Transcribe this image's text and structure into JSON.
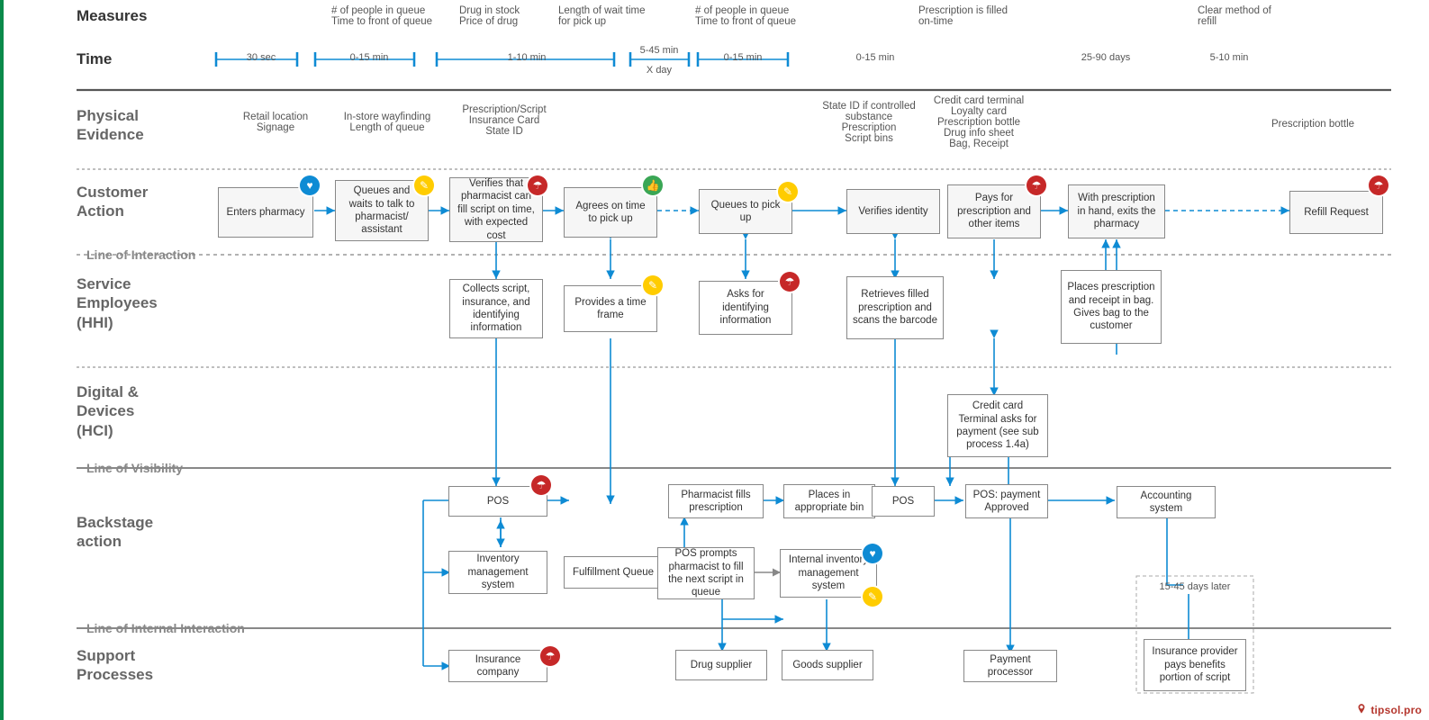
{
  "headers": {
    "measures": "Measures",
    "time": "Time",
    "physical": "Physical\nEvidence",
    "customer": "Customer\nAction",
    "service": "Service\nEmployees\n(HHI)",
    "digital": "Digital &\nDevices\n(HCI)",
    "backstage": "Backstage\naction",
    "support": "Support\nProcesses",
    "loi": "Line of Interaction",
    "lov": "Line of Visibility",
    "loii": "Line of Internal Interaction"
  },
  "measures": [
    "# of people in queue\nTime to front of queue",
    "Drug in stock\nPrice of drug",
    "Length of wait time\nfor pick up",
    "# of people in queue\nTime to front of queue",
    "Prescription is filled\non-time",
    "Clear method of\nrefill"
  ],
  "times": [
    "30 sec",
    "0-15 min",
    "1-10 min",
    "5-45 min",
    "X day",
    "0-15 min",
    "0-15 min",
    "25-90 days",
    "5-10 min"
  ],
  "physical": [
    "Retail location\nSignage",
    "In-store wayfinding\nLength of queue",
    "Prescription/Script\nInsurance Card\nState ID",
    "State ID if controlled\nsubstance\nPrescription\nScript bins",
    "Credit card terminal\nLoyalty card\nPrescription bottle\nDrug info sheet\nBag, Receipt",
    "Prescription bottle"
  ],
  "customer_boxes": [
    "Enters pharmacy",
    "Queues and waits to talk to pharmacist/ assistant",
    "Verifies that pharmacist can fill script on time, with expected cost",
    "Agrees on time to pick up",
    "Queues to pick up",
    "Verifies identity",
    "Pays for prescription and other items",
    "With prescription in hand, exits the pharmacy",
    "Refill Request"
  ],
  "service_boxes": [
    "Collects script, insurance, and identifying information",
    "Provides a time frame",
    "Asks for identifying information",
    "Retrieves filled prescription and scans the barcode",
    "Places prescription and receipt in bag. Gives bag to the customer"
  ],
  "digital_box": "Credit card Terminal asks for payment (see sub process 1.4a)",
  "backstage_boxes": [
    "POS",
    "Inventory management system",
    "Fulfillment Queue",
    "Insurance company",
    "Pharmacist fills prescription",
    "Places in appropriate bin",
    "POS prompts pharmacist to fill the next script in queue",
    "Internal inventory management system",
    "POS",
    "POS: payment Approved",
    "Accounting system"
  ],
  "support_boxes": [
    "Drug supplier",
    "Goods supplier",
    "Payment processor"
  ],
  "delayed": {
    "label": "15-45 days later",
    "box": "Insurance provider pays benefits portion of script"
  },
  "watermark": "tipsol.pro"
}
